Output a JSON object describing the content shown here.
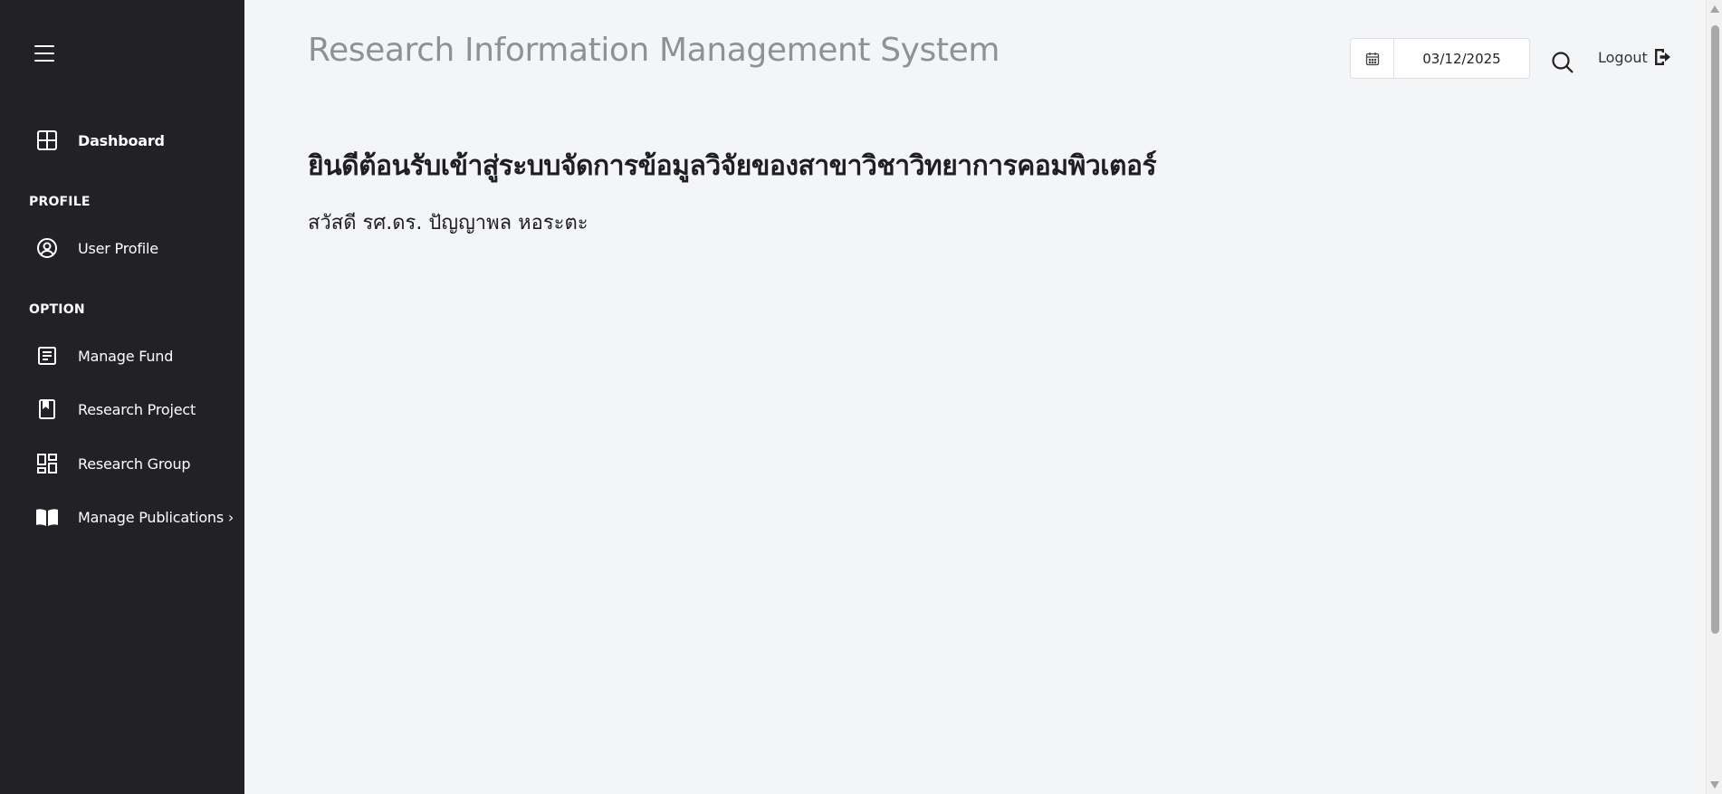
{
  "sidebar": {
    "menu_icon": "hamburger-icon",
    "dashboard": {
      "label": "Dashboard",
      "icon": "dashboard-grid-icon"
    },
    "profile_section": "PROFILE",
    "user_profile": {
      "label": "User Profile",
      "icon": "user-circle-icon"
    },
    "option_section": "OPTION",
    "items": [
      {
        "label": "Manage Fund",
        "icon": "document-lines-icon"
      },
      {
        "label": "Research Project",
        "icon": "bookmark-book-icon"
      },
      {
        "label": "Research Group",
        "icon": "group-grid-icon"
      },
      {
        "label": "Manage Publications ›",
        "icon": "open-book-icon"
      }
    ]
  },
  "header": {
    "title": "Research Information Management System",
    "date_value": "03/12/2025",
    "logout_label": "Logout"
  },
  "content": {
    "welcome": "ยินดีต้อนรับเข้าสู่ระบบจัดการข้อมูลวิจัยของสาขาวิชาวิทยาการคอมพิวเตอร์",
    "greeting": "สวัสดี รศ.ดร. ปัญญาพล หอระตะ"
  },
  "colors": {
    "sidebar_bg": "#222226",
    "page_bg": "#f4f5f7",
    "title_text": "#8e9196"
  }
}
